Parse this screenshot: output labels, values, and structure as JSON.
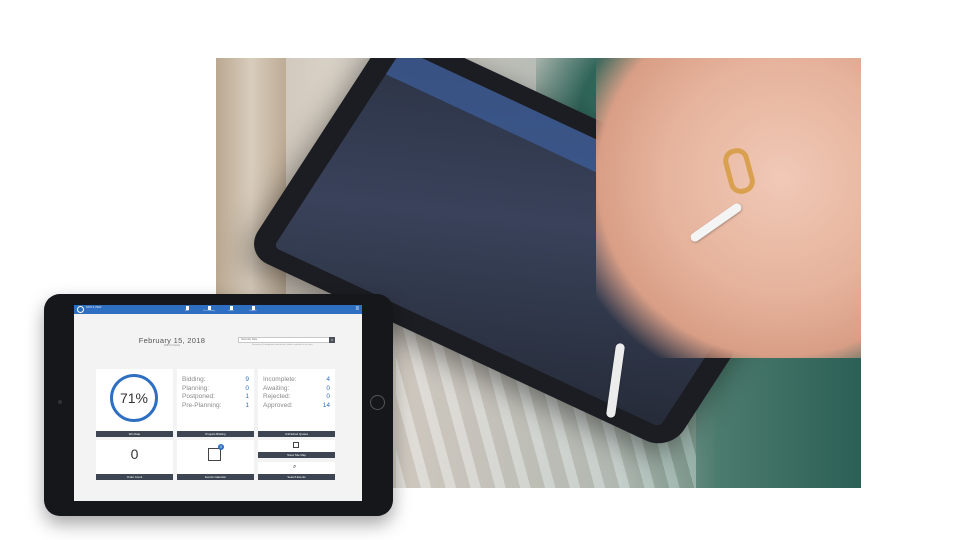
{
  "app": {
    "brand": "DATA II VIEW",
    "nav": [
      {
        "label": "Bids",
        "icon": "document-icon"
      },
      {
        "label": "Pre-Planning",
        "icon": "pencil-icon"
      },
      {
        "label": "Orders",
        "icon": "phone-icon"
      },
      {
        "label": "Reports",
        "icon": "chart-icon"
      }
    ],
    "menu_glyph": "≡"
  },
  "dashboard": {
    "date": "February 15, 2018",
    "date_sub": "(Set 2.0 Items)",
    "filter": {
      "value": "Saturday Data",
      "hint": "Showing all completed transactions (dates selected as of now)"
    },
    "win_rate": {
      "value": "71%",
      "label": "Win Rate"
    },
    "projects_bidding": {
      "label": "Projects Bidding",
      "rows": [
        {
          "name": "Bidding:",
          "value": "9"
        },
        {
          "name": "Planning:",
          "value": "0"
        },
        {
          "name": "Postponed:",
          "value": "1"
        },
        {
          "name": "Pre-Planning:",
          "value": "1"
        }
      ]
    },
    "unfinished_quotes": {
      "label": "Unfinished Quotes",
      "rows": [
        {
          "name": "Incomplete:",
          "value": "4"
        },
        {
          "name": "Awaiting:",
          "value": "0"
        },
        {
          "name": "Rejected:",
          "value": "0"
        },
        {
          "name": "Approved:",
          "value": "14"
        }
      ]
    },
    "order_count": {
      "value": "0",
      "label": "Order Count"
    },
    "events_calendar": {
      "label": "Events Calendar",
      "badge": "0"
    },
    "site_map": {
      "label": "Show Site Map"
    },
    "search_events": {
      "label": "Search Events",
      "glyph": "⌕"
    }
  },
  "colors": {
    "accent": "#2e6fc2",
    "card_footer": "#3d4553"
  }
}
